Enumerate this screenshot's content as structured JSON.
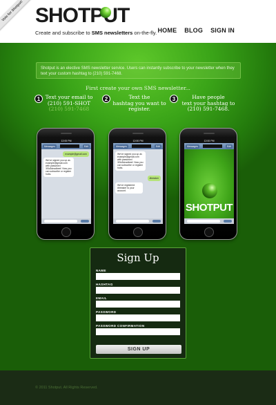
{
  "ribbon": {
    "text": "Vote for Shotput!"
  },
  "header": {
    "logo": "SHOTPUT",
    "tagline_pre": "Create and subscribe to ",
    "tagline_bold": "SMS newsletters",
    "tagline_post": " on-the-fly.",
    "nav": [
      "HOME",
      "BLOG",
      "SIGN IN"
    ]
  },
  "intro": "Shotput is an elective SMS newsletter service. Users can instantly subscribe to your newsletter when they text your custom hashtag to (210) 591-7468.",
  "first_create": "First create your own SMS newsletter...",
  "steps": [
    {
      "num": "1",
      "line1": "Text your email to",
      "line2": "(210) 591-SHOT",
      "sub": "(210) 591-7468"
    },
    {
      "num": "2",
      "line1": "Text the",
      "line2": "hashtag you want to",
      "line3": "register."
    },
    {
      "num": "3",
      "line1": "Have people",
      "line2": "text your hashtag to",
      "line3": "(210) 591-7468."
    }
  ],
  "phones": [
    {
      "status": "12:00 PM",
      "back": "Messages",
      "edit": "Edit",
      "msgs": [
        {
          "dir": "out",
          "text": "example@gmail.com"
        },
        {
          "dir": "in",
          "text": "We've signed you up as example@gmail.com with password 3f3c3deadbeef. Now you can subscribe or register hubs."
        }
      ]
    },
    {
      "status": "12:00 PM",
      "back": "Messages",
      "edit": "Edit",
      "msgs": [
        {
          "dir": "in",
          "text": "We've signed you up as example@gmail.com with password 3f3c3deadbeef. Now you can subscribe or register hubs."
        },
        {
          "dir": "out",
          "text": "#breaker"
        },
        {
          "dir": "in",
          "text": "We've registered #breaker to your account."
        }
      ]
    },
    {
      "status": "12:00 PM",
      "back": "Messages",
      "edit": "Edit",
      "brand": "SHOTPUT"
    }
  ],
  "signup": {
    "title": "Sign Up",
    "fields": [
      "NAME",
      "HASHTAG",
      "EMAIL",
      "PASSWORD",
      "PASSWORD CONFIRMATION"
    ],
    "button": "SIGN UP"
  },
  "footer": {
    "copy": "© 2011 Shotput. All Rights Reserved."
  },
  "colors": {
    "accent": "#3aa418",
    "dark": "#152a11"
  }
}
